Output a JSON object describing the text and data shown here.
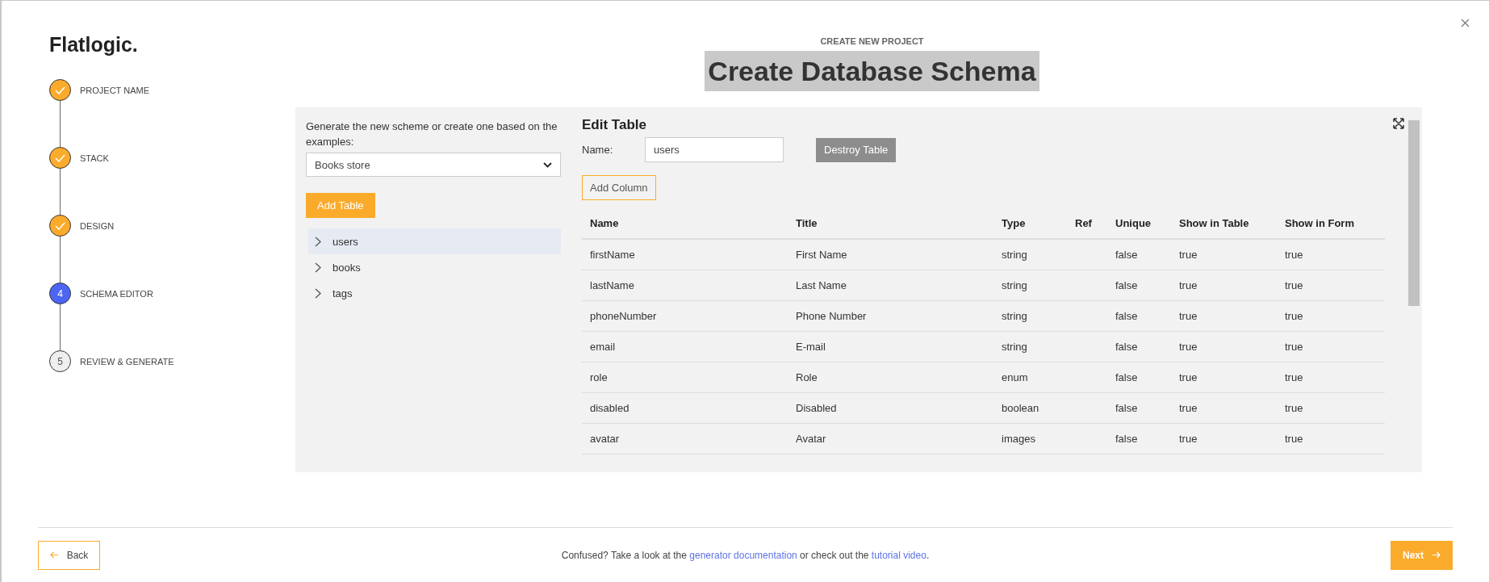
{
  "logo": "Flatlogic.",
  "steps": [
    {
      "label": "PROJECT NAME",
      "completed": true,
      "current": false
    },
    {
      "label": "STACK",
      "completed": true,
      "current": false
    },
    {
      "label": "DESIGN",
      "completed": true,
      "current": false
    },
    {
      "number": "4",
      "label": "SCHEMA EDITOR",
      "completed": false,
      "current": true
    },
    {
      "number": "5",
      "label": "REVIEW & GENERATE",
      "completed": false,
      "current": false
    }
  ],
  "header": {
    "eyebrow": "CREATE NEW PROJECT",
    "title": "Create Database Schema",
    "highlighted": true
  },
  "schema_panel": {
    "intro": "Generate the new scheme or create one based on the examples:",
    "example_select": {
      "value": "Books store"
    },
    "add_table_button": "Add Table",
    "tables": [
      {
        "label": "users",
        "selected": true
      },
      {
        "label": "books",
        "selected": false
      },
      {
        "label": "tags",
        "selected": false
      }
    ]
  },
  "edit_table": {
    "heading": "Edit Table",
    "name_label": "Name:",
    "name_value": "users",
    "destroy_button": "Destroy Table",
    "add_column_button": "Add Column",
    "columns": [
      "Name",
      "Title",
      "Type",
      "Ref",
      "Unique",
      "Show in Table",
      "Show in Form"
    ],
    "rows": [
      [
        "firstName",
        "First Name",
        "string",
        "",
        "false",
        "true",
        "true"
      ],
      [
        "lastName",
        "Last Name",
        "string",
        "",
        "false",
        "true",
        "true"
      ],
      [
        "phoneNumber",
        "Phone Number",
        "string",
        "",
        "false",
        "true",
        "true"
      ],
      [
        "email",
        "E-mail",
        "string",
        "",
        "false",
        "true",
        "true"
      ],
      [
        "role",
        "Role",
        "enum",
        "",
        "false",
        "true",
        "true"
      ],
      [
        "disabled",
        "Disabled",
        "boolean",
        "",
        "false",
        "true",
        "true"
      ],
      [
        "avatar",
        "Avatar",
        "images",
        "",
        "false",
        "true",
        "true"
      ]
    ]
  },
  "footer": {
    "back_button": "Back",
    "text_before": "Confused? Take a look at the",
    "link_docs": "generator documentation",
    "text_middle": "or check out the",
    "link_video": "tutorial video",
    "text_after": ".",
    "next_button": "Next"
  }
}
